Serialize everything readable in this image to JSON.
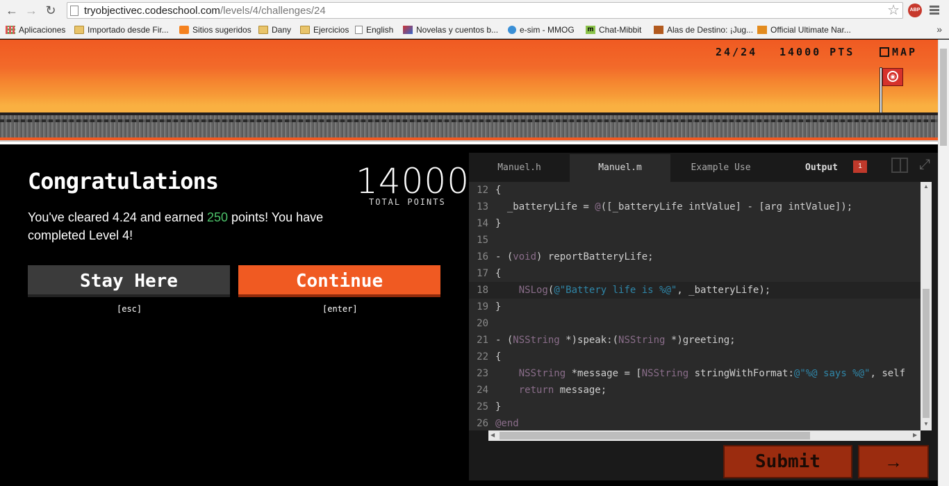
{
  "browser": {
    "url_host": "tryobjectivec.codeschool.com",
    "url_path": "/levels/4/challenges/24",
    "bookmarks": [
      {
        "label": "Aplicaciones",
        "icon": "apps-icon"
      },
      {
        "label": "Importado desde Fir...",
        "icon": "folder-icon"
      },
      {
        "label": "Sitios sugeridos",
        "icon": "suggested-sites-icon"
      },
      {
        "label": "Dany",
        "icon": "folder-icon"
      },
      {
        "label": "Ejercicios",
        "icon": "folder-icon"
      },
      {
        "label": "English",
        "icon": "page-icon"
      },
      {
        "label": "Novelas y cuentos b...",
        "icon": "novel-icon"
      },
      {
        "label": "e-sim - MMOG",
        "icon": "globe-icon"
      },
      {
        "label": "Chat-Mibbit",
        "icon": "mibbit-icon"
      },
      {
        "label": "Alas de Destino: ¡Jug...",
        "icon": "game-icon"
      },
      {
        "label": "Official Ultimate Nar...",
        "icon": "game-icon"
      }
    ],
    "more": "»",
    "abp_label": "ABP"
  },
  "hud": {
    "progress": "24/24",
    "points": "14000 PTS",
    "map": "MAP"
  },
  "result": {
    "title": "Congratulations",
    "total_points": "14000",
    "total_points_label": "TOTAL POINTS",
    "message_pre": "You've cleared 4.24 and earned ",
    "earned": "250",
    "message_post": " points! You have completed Level 4!",
    "stay_label": "Stay Here",
    "stay_key": "[esc]",
    "continue_label": "Continue",
    "continue_key": "[enter]"
  },
  "editor": {
    "tabs": [
      "Manuel.h",
      "Manuel.m",
      "Example Use",
      "Output"
    ],
    "active_tab": "Manuel.m",
    "output_count": "1",
    "lines": [
      {
        "n": "12",
        "code": "{"
      },
      {
        "n": "13",
        "code": "  _batteryLife = @([_batteryLife intValue] - [arg intValue]);"
      },
      {
        "n": "14",
        "code": "}"
      },
      {
        "n": "15",
        "code": ""
      },
      {
        "n": "16",
        "code": "- (void) reportBatteryLife;"
      },
      {
        "n": "17",
        "code": "{"
      },
      {
        "n": "18",
        "code": "    NSLog(@\"Battery life is %@\", _batteryLife);"
      },
      {
        "n": "19",
        "code": "}"
      },
      {
        "n": "20",
        "code": ""
      },
      {
        "n": "21",
        "code": "- (NSString *)speak:(NSString *)greeting;"
      },
      {
        "n": "22",
        "code": "{"
      },
      {
        "n": "23",
        "code": "    NSString *message = [NSString stringWithFormat:@\"%@ says %@\", self"
      },
      {
        "n": "24",
        "code": "    return message;"
      },
      {
        "n": "25",
        "code": "}"
      },
      {
        "n": "26",
        "code": "@end"
      }
    ],
    "submit_label": "Submit",
    "next_label": "→"
  },
  "colors": {
    "accent": "#f05a22",
    "earned_green": "#4cc26a",
    "editor_bg": "#2a2a2a"
  }
}
